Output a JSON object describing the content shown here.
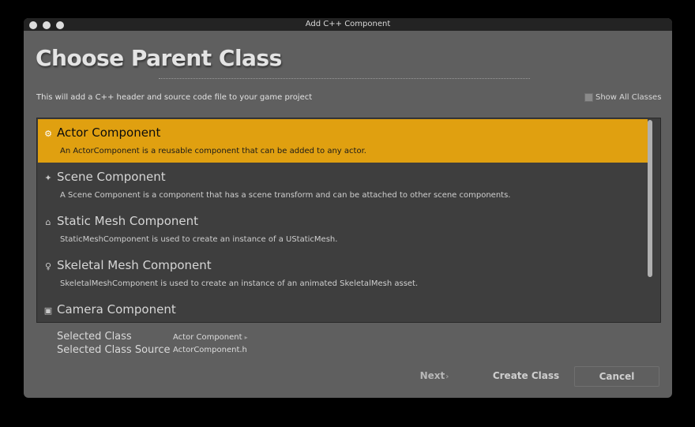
{
  "window": {
    "title": "Add C++ Component"
  },
  "heading": "Choose Parent Class",
  "description": "This will add a C++ header and source code file to your game project",
  "show_all_classes": {
    "label": "Show All Classes",
    "checked": false
  },
  "class_list": [
    {
      "name": "Actor Component",
      "description": "An ActorComponent is a reusable component that can be added to any actor.",
      "icon": "actor-component-icon",
      "selected": true
    },
    {
      "name": "Scene Component",
      "description": "A Scene Component is a component that has a scene transform and can be attached to other scene components.",
      "icon": "scene-component-icon",
      "selected": false
    },
    {
      "name": "Static Mesh Component",
      "description": "StaticMeshComponent is used to create an instance of a UStaticMesh.",
      "icon": "static-mesh-icon",
      "selected": false
    },
    {
      "name": "Skeletal Mesh Component",
      "description": "SkeletalMeshComponent is used to create an instance of an animated SkeletalMesh asset.",
      "icon": "skeletal-mesh-icon",
      "selected": false
    },
    {
      "name": "Camera Component",
      "description": "",
      "icon": "camera-component-icon",
      "selected": false
    }
  ],
  "selected_info": {
    "class_label": "Selected Class",
    "class_value": "Actor Component",
    "source_label": "Selected Class Source",
    "source_value": "ActorComponent.h"
  },
  "buttons": {
    "next": "Next",
    "create": "Create Class",
    "cancel": "Cancel"
  },
  "colors": {
    "selection": "#e0a010",
    "window_bg": "#5f5f5f",
    "list_bg": "#3e3e3e"
  }
}
